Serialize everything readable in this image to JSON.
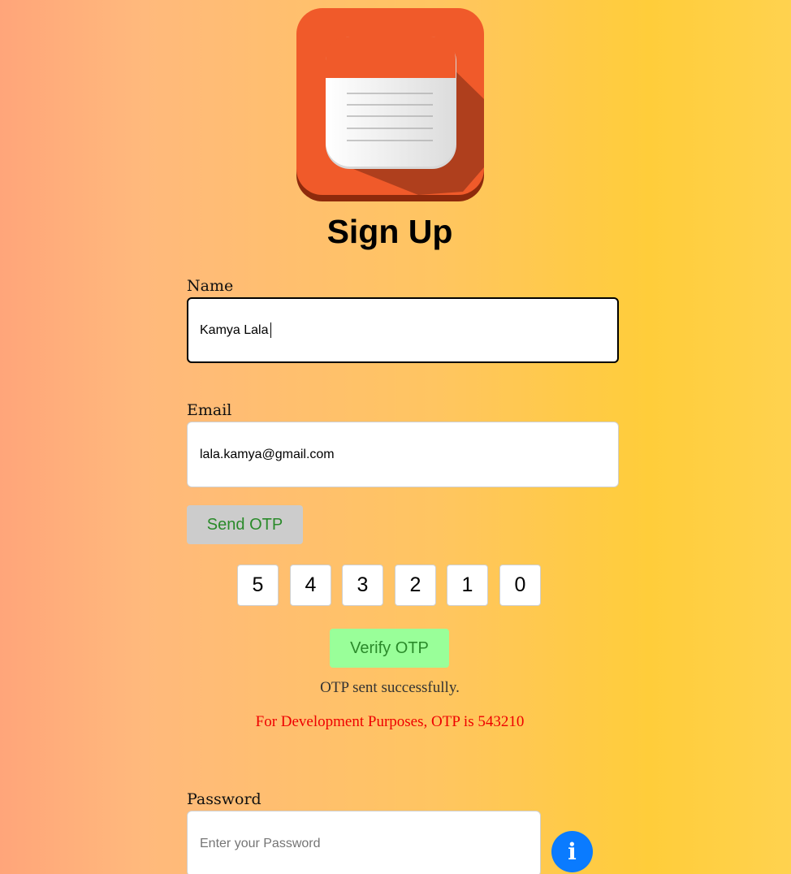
{
  "app": {
    "logo_icon": "notepad-icon",
    "title": "Sign Up"
  },
  "form": {
    "name": {
      "label": "Name",
      "value": "Kamya Lala"
    },
    "email": {
      "label": "Email",
      "value": "lala.kamya@gmail.com"
    },
    "send_otp_label": "Send OTP",
    "otp_digits": [
      "5",
      "4",
      "3",
      "2",
      "1",
      "0"
    ],
    "verify_otp_label": "Verify OTP",
    "status_message": "OTP sent successfully.",
    "dev_notice": "For Development Purposes, OTP is 543210",
    "password": {
      "label": "Password",
      "placeholder": "Enter your Password",
      "info_icon": "info-icon",
      "info_glyph": "i"
    }
  },
  "colors": {
    "logo_orange": "#f05a2a",
    "send_otp_bg": "#cccccc",
    "verify_otp_bg": "#99ff99",
    "button_text_green": "#2a8a2a",
    "dev_notice_red": "#ee0000",
    "info_blue": "#0a7bff"
  }
}
